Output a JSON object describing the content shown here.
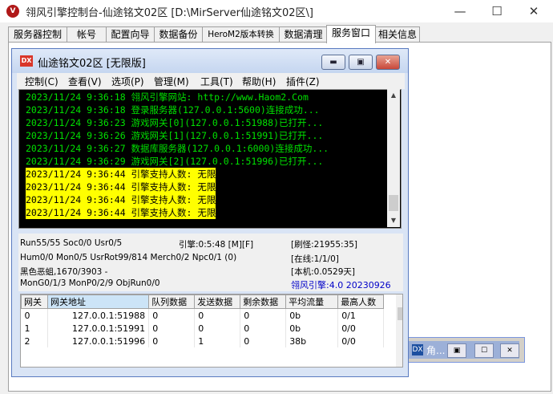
{
  "window": {
    "title": "翎风引擎控制台-仙途铭文02区 [D:\\MirServer仙途铭文02区\\]",
    "minimize": "—",
    "maximize": "☐",
    "close": "✕"
  },
  "tabs": [
    "服务器控制",
    "帐号",
    "配置向导",
    "数据备份",
    "HeroM2版本转换",
    "数据清理",
    "服务窗口",
    "相关信息"
  ],
  "bg_window": {
    "label": "角..."
  },
  "inner_window": {
    "title": "仙途铭文02区 [无限版]",
    "menu": [
      "控制(C)",
      "查看(V)",
      "选项(P)",
      "管理(M)",
      "工具(T)",
      "帮助(H)",
      "插件(Z)"
    ]
  },
  "log": [
    {
      "text": "2023/11/24 9:36:18 翎风引擎网站: http://www.Haom2.Com",
      "hl": false
    },
    {
      "text": "2023/11/24 9:36:18 登录服务器(127.0.0.1:5600)连接成功...",
      "hl": false
    },
    {
      "text": "2023/11/24 9:36:23 游戏网关[0](127.0.0.1:51988)已打开...",
      "hl": false
    },
    {
      "text": "2023/11/24 9:36:26 游戏网关[1](127.0.0.1:51991)已打开...",
      "hl": false
    },
    {
      "text": "2023/11/24 9:36:27 数据库服务器(127.0.0.1:6000)连接成功...",
      "hl": false
    },
    {
      "text": "2023/11/24 9:36:29 游戏网关[2](127.0.0.1:51996)已打开...",
      "hl": false
    },
    {
      "text": "2023/11/24 9:36:44 引擎支持人数: 无限",
      "hl": true
    },
    {
      "text": "2023/11/24 9:36:44 引擎支持人数: 无限",
      "hl": true
    },
    {
      "text": "2023/11/24 9:36:44 引擎支持人数: 无限",
      "hl": true
    },
    {
      "text": "2023/11/24 9:36:44 引擎支持人数: 无限",
      "hl": true
    }
  ],
  "status": {
    "run": "Run55/55 Soc0/0 Usr0/5",
    "engine_time": "引擎:0:5:48 [M][F]",
    "refresh": "[刷怪:21955:35]",
    "hum": "Hum0/0 Mon0/5 UsrRot99/814 Merch0/2 Npc0/1 (0)",
    "online": "[在线:1/1/0]",
    "map": "黑色恶蛆,1670/3903 -",
    "local": "[本机:0.0529天]",
    "mongo": "MonG0/1/3 MonP0/2/9 ObjRun0/0",
    "version": "翎风引擎:4.0 20230926"
  },
  "grid": {
    "headers": [
      "网关",
      "网关地址",
      "队列数据",
      "发送数据",
      "剩余数据",
      "平均流量",
      "最高人数"
    ],
    "rows": [
      [
        "0",
        "127.0.0.1:51988",
        "0",
        "0",
        "0",
        "0b",
        "0/1"
      ],
      [
        "1",
        "127.0.0.1:51991",
        "0",
        "0",
        "0",
        "0b",
        "0/0"
      ],
      [
        "2",
        "127.0.0.1:51996",
        "0",
        "1",
        "0",
        "38b",
        "0/0"
      ]
    ]
  }
}
